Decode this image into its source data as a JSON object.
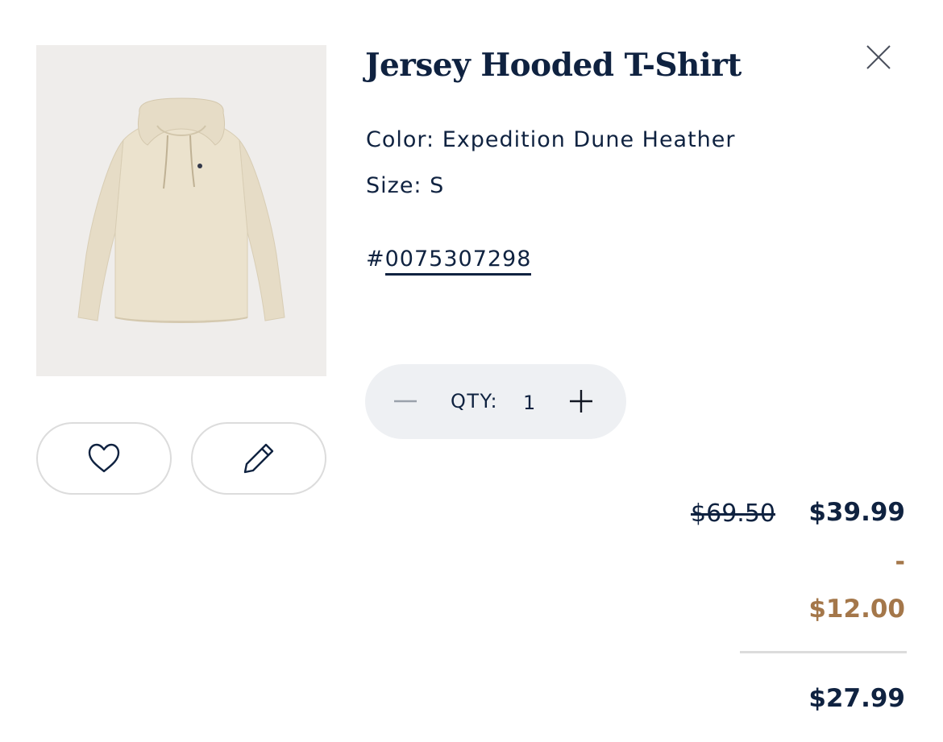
{
  "product": {
    "title": "Jersey Hooded T-Shirt",
    "color": "Color: Expedition Dune Heather",
    "size": "Size: S",
    "sku_prefix": "#",
    "sku": "0075307298",
    "image_icon": "hooded-tshirt-image"
  },
  "quantity": {
    "label": "QTY:",
    "value": "1"
  },
  "pricing": {
    "original": "$69.50",
    "sale": "$39.99",
    "discount_dash": "-",
    "discount": "$12.00",
    "total": "$27.99"
  },
  "actions": {
    "wishlist_icon": "heart-icon",
    "edit_icon": "pencil-icon",
    "close_icon": "close-icon",
    "minus_icon": "minus-icon",
    "plus_icon": "plus-icon"
  },
  "colors": {
    "navy": "#0f2240",
    "discount": "#a4774a",
    "stepper_bg": "#eef0f3",
    "image_bg": "#efedeb",
    "border": "#dcdcdc"
  }
}
